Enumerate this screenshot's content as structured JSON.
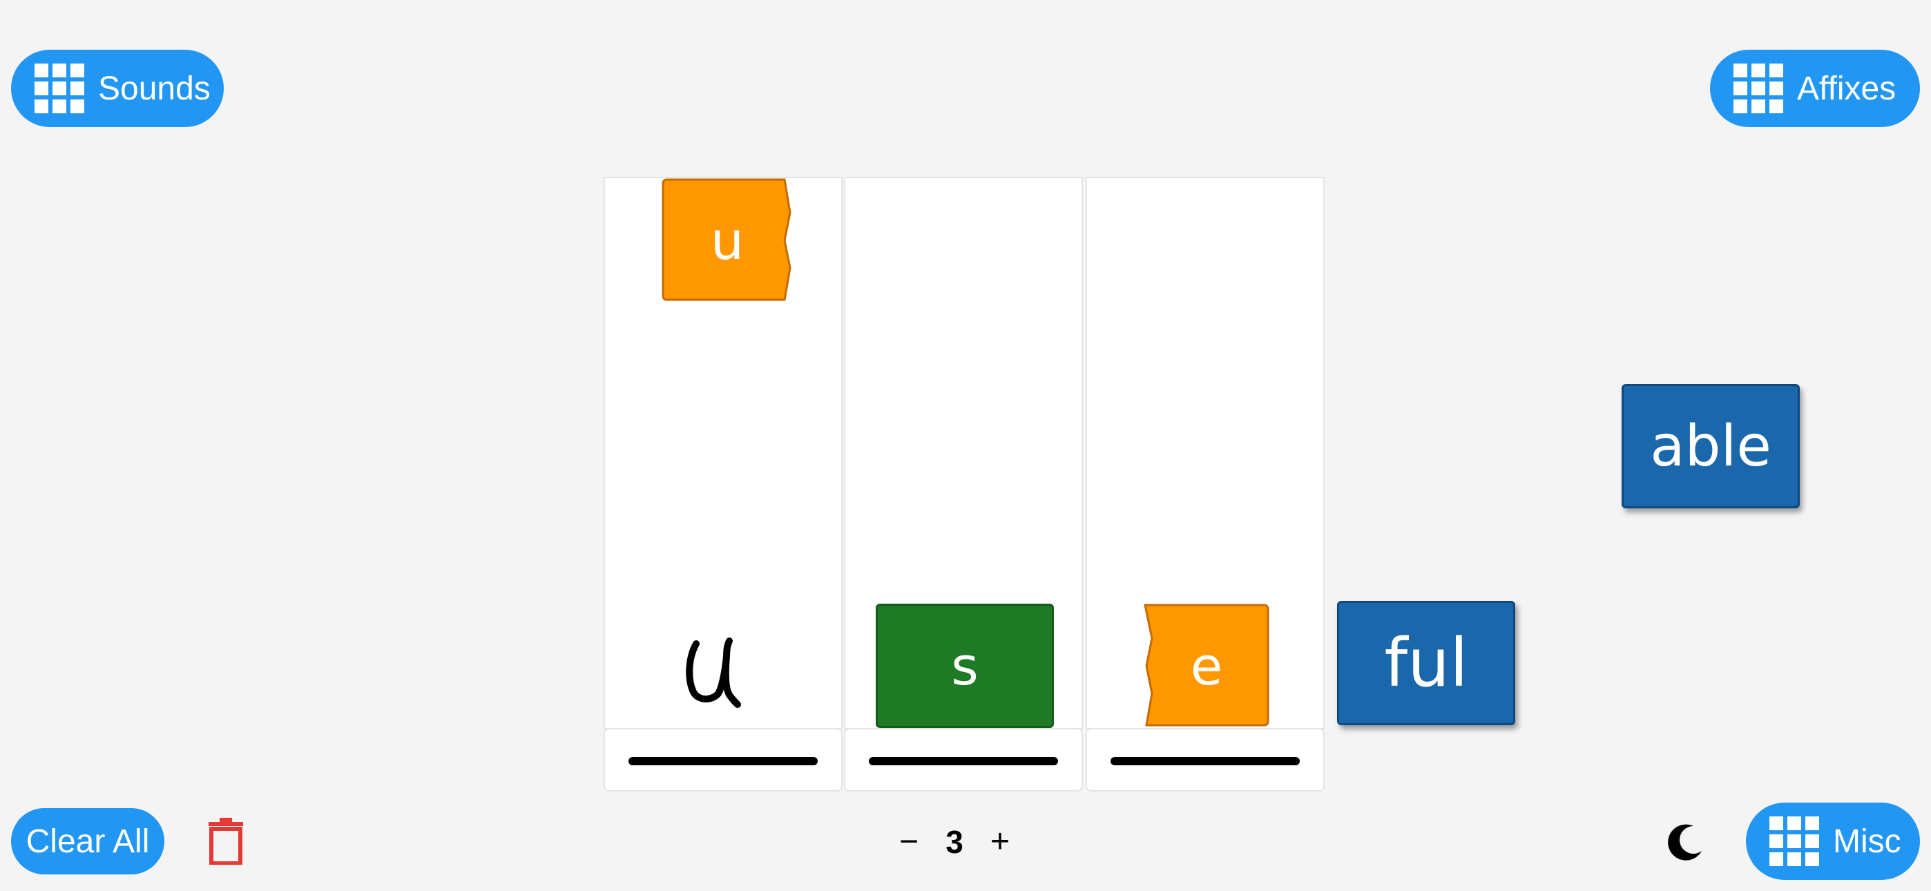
{
  "top_left_button": {
    "label": "Sounds",
    "icon": "grid-icon"
  },
  "top_right_button": {
    "label": "Affixes",
    "icon": "grid-icon"
  },
  "bottom_left_button": {
    "label": "Clear All"
  },
  "bottom_right_button": {
    "label": "Misc",
    "icon": "grid-icon"
  },
  "trash": {
    "icon": "trash-icon",
    "color": "#e53935"
  },
  "theme_toggle": {
    "icon": "moon-icon"
  },
  "stepper": {
    "minus": "−",
    "value": "3",
    "plus": "+"
  },
  "columns": [
    {
      "tiles": [
        "u"
      ],
      "handwriting": "u"
    },
    {
      "tiles": [
        "s"
      ]
    },
    {
      "tiles": [
        "e"
      ]
    }
  ],
  "loose_tiles": {
    "able": "able",
    "ful": "ful"
  },
  "colors": {
    "accent": "#2196f3",
    "vowel_orange": "#ff9800",
    "consonant_green": "#1f7a26",
    "affix_blue": "#1a68ab",
    "background": "#f4f4f4"
  }
}
